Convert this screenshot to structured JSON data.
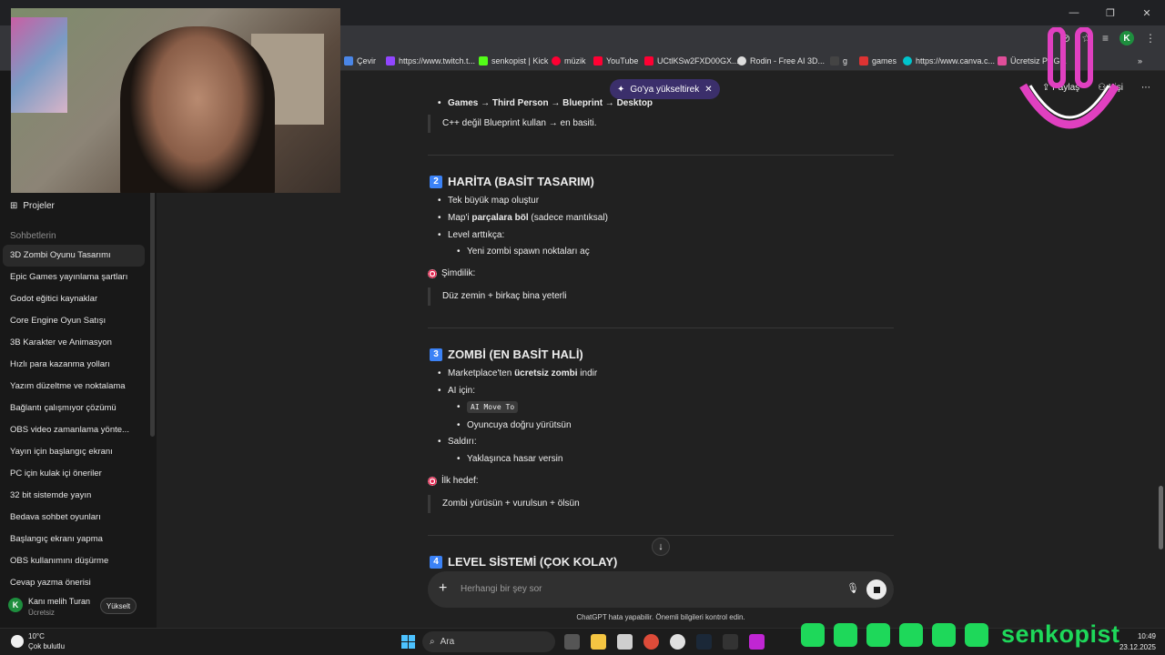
{
  "bookmarks": [
    {
      "label": "Çevir",
      "color": "#4a86e8"
    },
    {
      "label": "https://www.twitch.t...",
      "color": "#9146ff"
    },
    {
      "label": "senkopist | Kick",
      "color": "#53fc18"
    },
    {
      "label": "müzik",
      "color": "#ff0033"
    },
    {
      "label": "YouTube",
      "color": "#ff0033"
    },
    {
      "label": "UCtlKSw2FXD00GX...",
      "color": "#ff0033"
    },
    {
      "label": "Rodin - Free AI 3D...",
      "color": "#dddddd"
    },
    {
      "label": "g",
      "color": "#222222"
    },
    {
      "label": "games",
      "color": "#d33"
    },
    {
      "label": "https://www.canva.c...",
      "color": "#00c4cc"
    },
    {
      "label": "Ücretsiz PNG...",
      "color": "#e04e9a"
    }
  ],
  "sidebar": {
    "projects_label": "Projeler",
    "chats_heading": "Sohbetlerin",
    "chats": [
      "3D Zombi Oyunu Tasarımı",
      "Epic Games yayınlama şartları",
      "Godot eğitici kaynaklar",
      "Core Engine Oyun Satışı",
      "3B Karakter ve Animasyon",
      "Hızlı para kazanma yolları",
      "Yazım düzeltme ve noktalama",
      "Bağlantı çalışmıyor çözümü",
      "OBS video zamanlama yönte...",
      "Yayın için başlangıç ekranı",
      "PC için kulak içi öneriler",
      "32 bit sistemde yayın",
      "Bedava sohbet oyunları",
      "Başlangıç ekranı yapma",
      "OBS kullanımını düşürme",
      "Cevap yazma önerisi"
    ],
    "user": {
      "initial": "K",
      "name": "Kanı melih Turan",
      "plan": "Ücretsiz",
      "upgrade": "Yükselt"
    }
  },
  "header": {
    "upgrade_pill": "Go'ya yükseltirek",
    "share": "Paylaş",
    "people": "Kişi"
  },
  "content": {
    "top_line": "Games → Third Person → Blueprint → Desktop",
    "quote1": "C++ değil Blueprint kullan → en basiti.",
    "s2_num": "2",
    "s2_title": "HARİTA (BASİT TASARIM)",
    "s2_li1": "Tek büyük map oluştur",
    "s2_li2_a": "Map'i ",
    "s2_li2_b": "parçalara böl",
    "s2_li2_c": " (sadece mantıksal)",
    "s2_li3": "Level arttıkça:",
    "s2_li3_sub": "Yeni zombi spawn noktaları aç",
    "s2_callout": "Şimdilik:",
    "s2_quote": "Düz zemin + birkaç bina yeterli",
    "s3_num": "3",
    "s3_title": "ZOMBİ (EN BASİT HALİ)",
    "s3_li1_a": "Marketplace'ten ",
    "s3_li1_b": "ücretsiz zombi",
    "s3_li1_c": " indir",
    "s3_li2": "AI için:",
    "s3_code": "AI Move To",
    "s3_li2_sub2": "Oyuncuya doğru yürütsün",
    "s3_li3": "Saldırı:",
    "s3_li3_sub": "Yaklaşınca hasar versin",
    "s3_callout": "İlk hedef:",
    "s3_quote": "Zombi yürüsün + vurulsun + ölsün",
    "s4_num": "4",
    "s4_title": "LEVEL SİSTEMİ (ÇOK KOLAY)"
  },
  "composer": {
    "placeholder": "Herhangi bir şey sor",
    "disclaimer": "ChatGPT hata yapabilir. Önemli bilgileri kontrol edin."
  },
  "taskbar": {
    "weather_temp": "10°C",
    "weather_desc": "Çok bulutlu",
    "search": "Ara",
    "time": "10:49",
    "date": "23.12.2025"
  },
  "overlay": {
    "brand": "senkopist"
  }
}
